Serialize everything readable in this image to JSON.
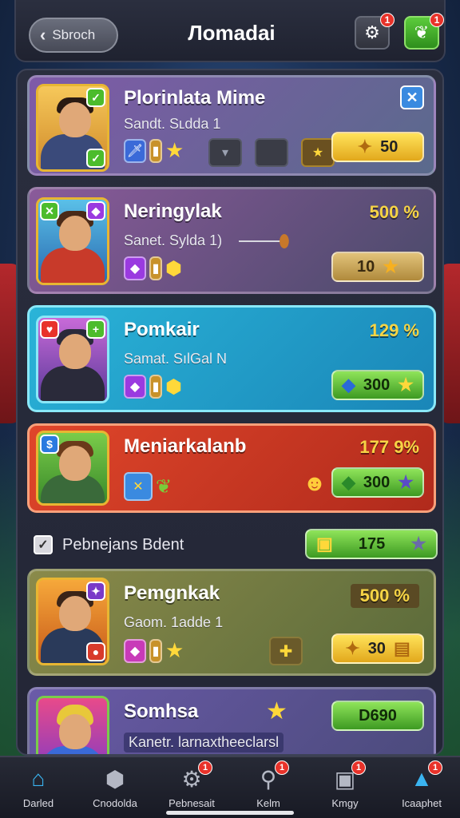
{
  "header": {
    "back_label": "Sbroch",
    "title": "Лomadai",
    "settings_badge": "1",
    "leaf_badge": "1"
  },
  "cards": [
    {
      "name": "Plorinlata Mime",
      "sub": "Sandt. Sʟdda 1",
      "pill_value": "50",
      "colors": {
        "bg": "#7a5aa0",
        "accent": "#e8b632"
      }
    },
    {
      "name": "Neringylak",
      "sub": "Sanet. Sylda 1)",
      "pct": "500 %",
      "pill_value": "10"
    },
    {
      "name": "Pomkair",
      "sub": "Samat. SılGal N",
      "pct": "129 %",
      "pill_value": "300"
    },
    {
      "name": "Meniarkalanb",
      "pct": "177 9%",
      "pill_value": "300"
    },
    {
      "name": "Pemgnkak",
      "sub": "Gaom. 1adde 1",
      "pct": "500 %",
      "pill_value": "30"
    },
    {
      "name": "Somhsa",
      "sub": "Kanetr. larnaxtheeclarsl",
      "pill_value": "D690"
    }
  ],
  "filter": {
    "label": "Pebnejans Bdent",
    "checked": true,
    "pill_value": "175"
  },
  "nav": [
    {
      "label": "Darled",
      "icon": "home-icon",
      "active": true
    },
    {
      "label": "Cnodolda",
      "icon": "cube-icon"
    },
    {
      "label": "Pebnesait",
      "icon": "gear-icon",
      "badge": "1"
    },
    {
      "label": "Kelm",
      "icon": "search-icon",
      "badge": "1"
    },
    {
      "label": "Kmgy",
      "icon": "camera-icon",
      "badge": "1"
    },
    {
      "label": "Icaaphet",
      "icon": "chart-icon",
      "badge": "1"
    }
  ]
}
